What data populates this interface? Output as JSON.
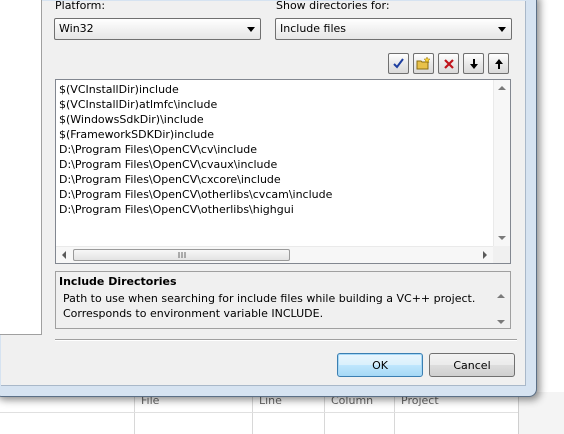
{
  "background_app": {
    "columns": [
      "File",
      "Line",
      "Column",
      "Project"
    ]
  },
  "platform": {
    "label": "Platform:",
    "value": "Win32"
  },
  "show_dirs": {
    "label": "Show directories for:",
    "value": "Include files"
  },
  "toolbar": {
    "icons": [
      "checkmark-icon",
      "new-folder-icon",
      "delete-icon",
      "move-down-icon",
      "move-up-icon"
    ]
  },
  "directories": [
    "$(VCInstallDir)include",
    "$(VCInstallDir)atlmfc\\include",
    "$(WindowsSdkDir)\\include",
    "$(FrameworkSDKDir)include",
    "D:\\Program Files\\OpenCV\\cv\\include",
    "D:\\Program Files\\OpenCV\\cvaux\\include",
    "D:\\Program Files\\OpenCV\\cxcore\\include",
    "D:\\Program Files\\OpenCV\\otherlibs\\cvcam\\include",
    "D:\\Program Files\\OpenCV\\otherlibs\\highgui"
  ],
  "description": {
    "title": "Include Directories",
    "text": "Path to use when searching for include files while building a VC++ project. Corresponds to environment variable INCLUDE."
  },
  "buttons": {
    "ok": "OK",
    "cancel": "Cancel"
  },
  "colors": {
    "accent": "#3c7fb1",
    "frame": "#d6e3f1",
    "delete_red": "#c0141c",
    "check_blue": "#1e3fa0"
  }
}
